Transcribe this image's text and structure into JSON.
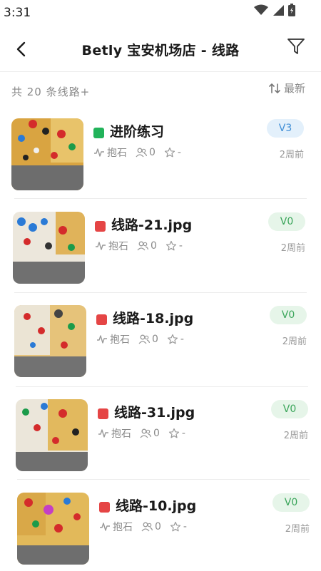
{
  "status": {
    "time": "3:31"
  },
  "header": {
    "title": "Betly 宝安机场店 - 线路"
  },
  "summary": {
    "count_text": "共 20 条线路+",
    "sort_label": "最新"
  },
  "routes": [
    {
      "name": "进阶练习",
      "status_color": "#22b35a",
      "type": "抱石",
      "climbers": "0",
      "rating": "-",
      "grade": "V3",
      "grade_bg": "#e3f0fb",
      "grade_fg": "#3f8ed6",
      "time_ago": "2周前"
    },
    {
      "name": "线路-21.jpg",
      "status_color": "#e54545",
      "type": "抱石",
      "climbers": "0",
      "rating": "-",
      "grade": "V0",
      "grade_bg": "#e6f5e9",
      "grade_fg": "#3aa55a",
      "time_ago": "2周前"
    },
    {
      "name": "线路-18.jpg",
      "status_color": "#e54545",
      "type": "抱石",
      "climbers": "0",
      "rating": "-",
      "grade": "V0",
      "grade_bg": "#e6f5e9",
      "grade_fg": "#3aa55a",
      "time_ago": "2周前"
    },
    {
      "name": "线路-31.jpg",
      "status_color": "#e54545",
      "type": "抱石",
      "climbers": "0",
      "rating": "-",
      "grade": "V0",
      "grade_bg": "#e6f5e9",
      "grade_fg": "#3aa55a",
      "time_ago": "2周前"
    },
    {
      "name": "线路-10.jpg",
      "status_color": "#e54545",
      "type": "抱石",
      "climbers": "0",
      "rating": "-",
      "grade": "V0",
      "grade_bg": "#e6f5e9",
      "grade_fg": "#3aa55a",
      "time_ago": "2周前"
    }
  ]
}
